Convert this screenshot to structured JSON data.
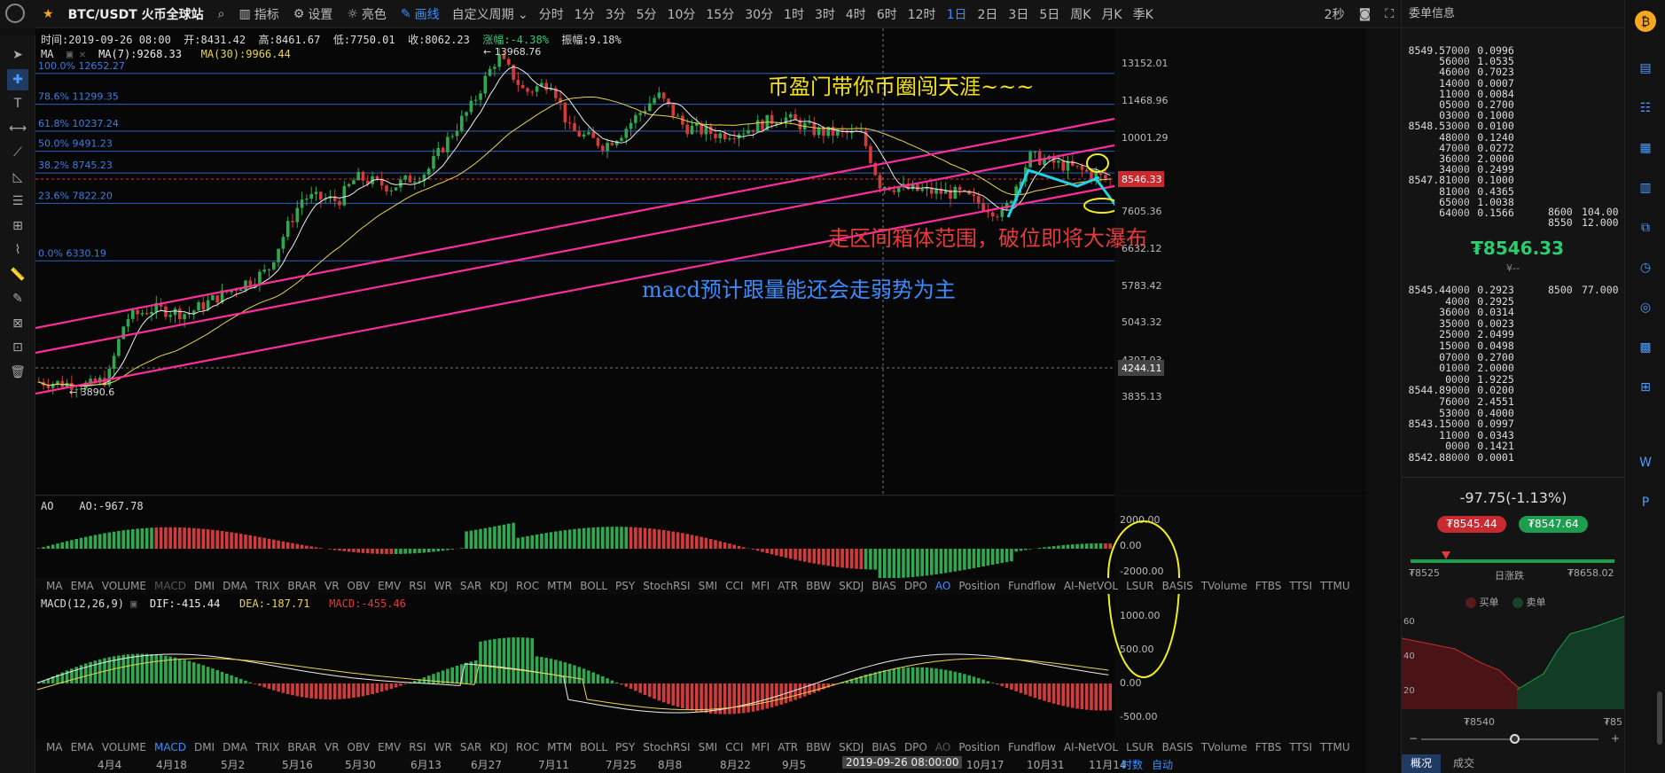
{
  "toolbar": {
    "symbol": "BTC/USDT 火币全球站",
    "items": [
      "指标",
      "设置",
      "亮色",
      "画线"
    ],
    "periods": [
      "自定义周期",
      "分时",
      "1分",
      "3分",
      "5分",
      "10分",
      "15分",
      "30分",
      "1时",
      "3时",
      "4时",
      "6时",
      "12时",
      "1日",
      "2日",
      "3日",
      "5日",
      "周K",
      "月K",
      "季K"
    ],
    "active_period": "1日",
    "refresh": "2秒"
  },
  "ohlc": {
    "time": "时间:2019-09-26 08:00",
    "open": "开:8431.42",
    "high": "高:8461.67",
    "low": "低:7750.01",
    "close": "收:8062.23",
    "change": "涨幅:-4.38%",
    "amplitude": "振幅:9.18%"
  },
  "ma_line": {
    "label": "MA",
    "ma7": "MA(7):9268.33",
    "ma30": "MA(30):9966.44"
  },
  "fib_levels": [
    {
      "label": "100.0% 12652.27",
      "price": 12652.27
    },
    {
      "label": "78.6% 11299.35",
      "price": 11299.35
    },
    {
      "label": "61.8% 10237.24",
      "price": 10237.24
    },
    {
      "label": "50.0% 9491.23",
      "price": 9491.23
    },
    {
      "label": "38.2% 8745.23",
      "price": 8745.23
    },
    {
      "label": "23.6% 7822.20",
      "price": 7822.2
    },
    {
      "label": "0.0% 6330.19",
      "price": 6330.19
    }
  ],
  "price_axis": [
    "13152.01",
    "11468.96",
    "10001.29",
    "8546.33",
    "7605.36",
    "6632.12",
    "5783.42",
    "5043.32",
    "4397.93",
    "4244.11",
    "3835.13"
  ],
  "high_mark": "← 13968.76",
  "low_mark": "← 3890.6",
  "current_price_tag": "8546.33",
  "last_tag": "4244.11",
  "annotations": {
    "title": "币盈门带你币圈闯天涯~~~",
    "range": "走区间箱体范围，破位即将大瀑布",
    "macd_note": "macd预计跟量能还会走弱势为主"
  },
  "ao": {
    "label": "AO",
    "value": "AO:-967.78",
    "axis": [
      "2000.00",
      "0.00",
      "-2000.00"
    ]
  },
  "macd": {
    "label": "MACD(12,26,9)",
    "dif": "DIF:-415.44",
    "dea": "DEA:-187.71",
    "macd": "MACD:-455.46",
    "axis": [
      "1000.00",
      "500.00",
      "0.00",
      "-500.00"
    ]
  },
  "indicators": [
    "MA",
    "EMA",
    "VOLUME",
    "MACD",
    "DMI",
    "DMA",
    "TRIX",
    "BRAR",
    "VR",
    "OBV",
    "EMV",
    "RSI",
    "WR",
    "SAR",
    "KDJ",
    "ROC",
    "MTM",
    "BOLL",
    "PSY",
    "StochRSI",
    "SMI",
    "CCI",
    "MFI",
    "ATR",
    "BBW",
    "SKDJ",
    "BIAS",
    "DPO",
    "AO",
    "Position",
    "Fundflow",
    "AI-NetVOL",
    "LSUR",
    "BASIS",
    "TVolume",
    "FTBS",
    "TTSI",
    "TTMU"
  ],
  "dates": [
    "4月4",
    "4月18",
    "5月2",
    "5月16",
    "5月30",
    "6月13",
    "6月27",
    "7月11",
    "7月25",
    "8月8",
    "8月22",
    "9月5",
    "2019-09-26 08:00:00",
    "10月17",
    "10月31",
    "11月14"
  ],
  "bottom_right": [
    "时数",
    "自动"
  ],
  "book": {
    "title": "委单信息",
    "asks": [
      [
        "8549.57",
        "000",
        "0.0996"
      ],
      [
        "56",
        "000",
        "1.0535"
      ],
      [
        "46",
        "000",
        "0.7023"
      ],
      [
        "14",
        "000",
        "0.0007"
      ],
      [
        "11",
        "000",
        "0.0084"
      ],
      [
        "05",
        "000",
        "0.2700"
      ],
      [
        "03",
        "000",
        "0.1000"
      ],
      [
        "8548.53",
        "000",
        "0.0100"
      ],
      [
        "48",
        "000",
        "0.1240"
      ],
      [
        "47",
        "000",
        "0.0272"
      ],
      [
        "36",
        "000",
        "2.0000"
      ],
      [
        "34",
        "000",
        "0.2499"
      ],
      [
        "8547.81",
        "000",
        "0.1000"
      ],
      [
        "81",
        "000",
        "0.4365"
      ],
      [
        "65",
        "000",
        "1.0038"
      ],
      [
        "64",
        "000",
        "0.1566"
      ]
    ],
    "bids": [
      [
        "8545.44",
        "000",
        "0.2923"
      ],
      [
        "4",
        "000",
        "0.2925"
      ],
      [
        "36",
        "000",
        "0.0314"
      ],
      [
        "35",
        "000",
        "0.0023"
      ],
      [
        "25",
        "000",
        "2.0499"
      ],
      [
        "15",
        "000",
        "0.0498"
      ],
      [
        "07",
        "000",
        "0.2700"
      ],
      [
        "01",
        "000",
        "2.0000"
      ],
      [
        "0",
        "000",
        "1.9225"
      ],
      [
        "8544.89",
        "000",
        "0.0200"
      ],
      [
        "76",
        "000",
        "2.4551"
      ],
      [
        "53",
        "000",
        "0.4000"
      ],
      [
        "8543.15",
        "000",
        "0.0997"
      ],
      [
        "11",
        "000",
        "0.0343"
      ],
      [
        "0",
        "000",
        "0.1421"
      ],
      [
        "8542.88",
        "000",
        "0.0001"
      ]
    ],
    "side_asks": [
      [
        "8600",
        "104.00"
      ],
      [
        "8550",
        "12.000"
      ]
    ],
    "side_bids": [
      [
        "8500",
        "77.000"
      ]
    ],
    "last_price": "₮8546.33",
    "last_sub": "¥--",
    "change": "-97.75(-1.13%)",
    "bid_btn": "₮8545.44",
    "ask_btn": "₮8547.64",
    "low_label": "₮8525",
    "range_label": "日涨跌",
    "high_label": "₮8658.02",
    "legend_buy": "买单",
    "legend_sell": "卖单",
    "depth_axis": [
      "60",
      "40",
      "20"
    ],
    "depth_price_left": "₮8540",
    "depth_price_right": "₮85",
    "tabs": [
      "概况",
      "成交"
    ]
  }
}
